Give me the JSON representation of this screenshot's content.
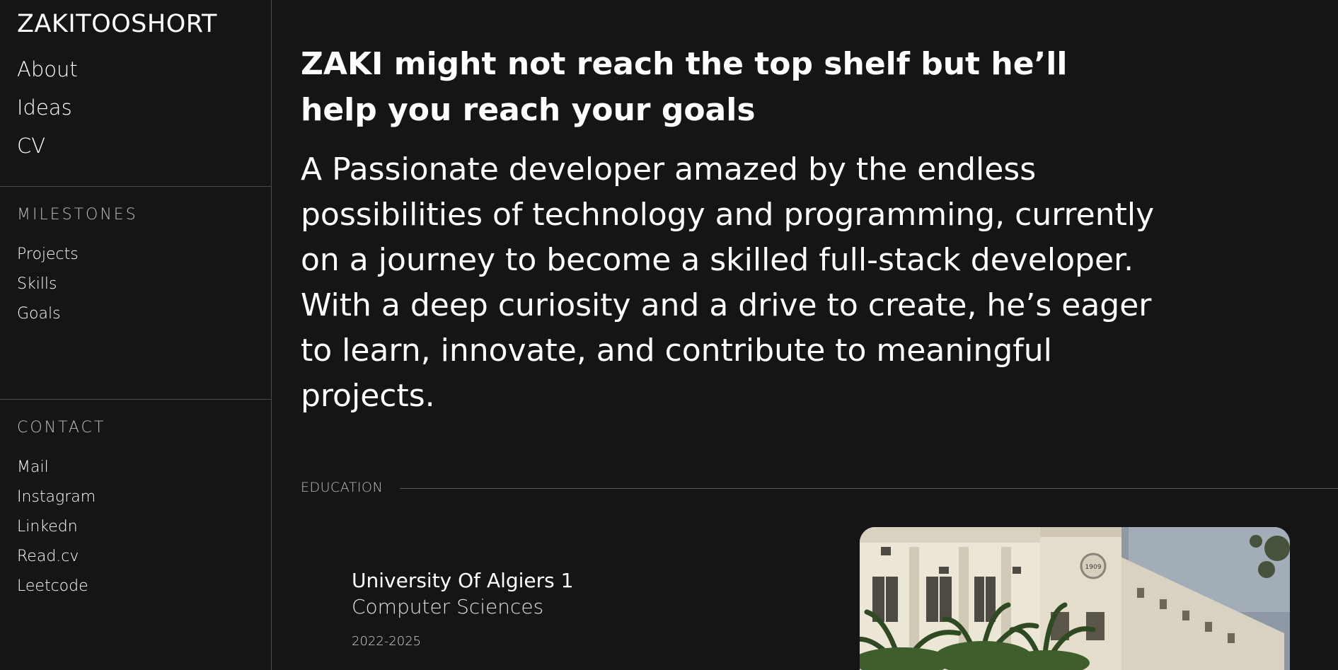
{
  "sidebar": {
    "brand": "ZAKITOOSHORT",
    "nav": [
      {
        "label": "About"
      },
      {
        "label": "Ideas"
      },
      {
        "label": "CV"
      }
    ],
    "milestones": {
      "title": "MILESTONES",
      "items": [
        {
          "label": "Projects"
        },
        {
          "label": "Skills"
        },
        {
          "label": "Goals"
        }
      ]
    },
    "contact": {
      "title": "CONTACT",
      "items": [
        {
          "label": "Mail"
        },
        {
          "label": "Instagram"
        },
        {
          "label": "Linkedn"
        },
        {
          "label": "Read.cv"
        },
        {
          "label": "Leetcode"
        }
      ]
    }
  },
  "main": {
    "headline": "ZAKI might not reach the top shelf but he’ll help you reach your goals",
    "intro_paragraph_1": "A Passionate developer amazed by the endless possibilities of technology and programming, currently on a journey to become a skilled full-stack developer.",
    "intro_paragraph_2": "With a deep curiosity and a drive to create, he’s eager to learn, innovate, and contribute to meaningful projects.",
    "education": {
      "label": "EDUCATION",
      "school": "University Of Algiers 1",
      "degree": "Computer Sciences",
      "years": "2022-2025",
      "image_plaque": "1909"
    }
  },
  "colors": {
    "background": "#151515",
    "text": "#ffffff",
    "muted": "#bdbdbd",
    "divider": "#4a4a4a"
  }
}
